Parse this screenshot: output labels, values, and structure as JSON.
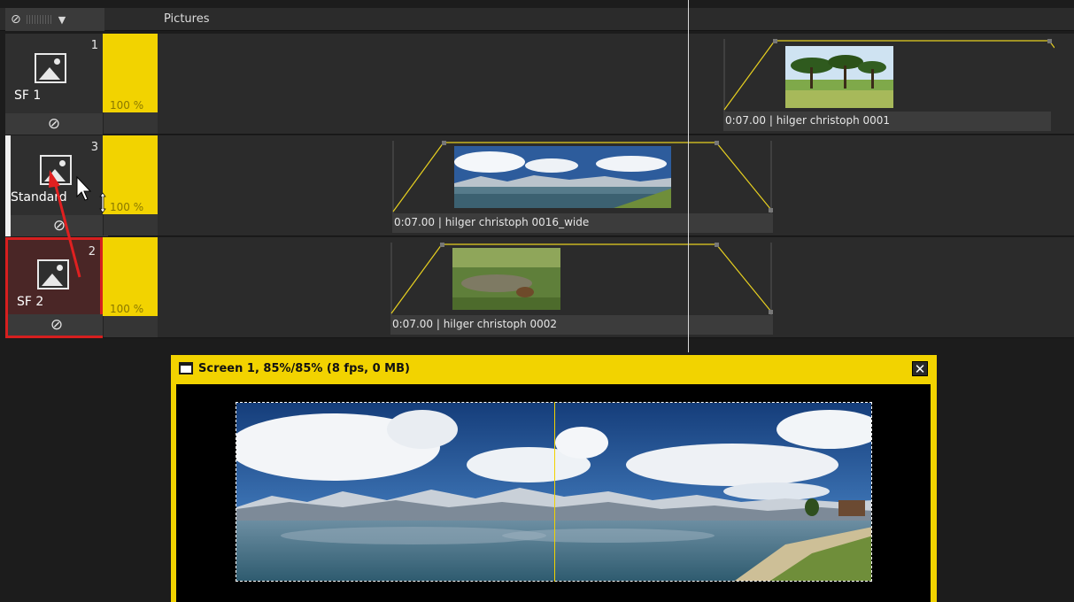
{
  "topbar": {
    "title": "Pictures",
    "no_icon": "⊘",
    "dropdown_icon": "▼"
  },
  "tracks": [
    {
      "number": "1",
      "label": "SF 1",
      "volume": "100 %",
      "footer_icon": "⊘"
    },
    {
      "number": "3",
      "label": "Standard",
      "volume": "100 %",
      "footer_icon": "⊘"
    },
    {
      "number": "2",
      "label": "SF 2",
      "volume": "100 %",
      "footer_icon": "⊘"
    }
  ],
  "clips": [
    {
      "caption": "0:07.00 | hilger christoph 0001"
    },
    {
      "caption": "0:07.00 | hilger christoph 0016_wide"
    },
    {
      "caption": "0:07.00 | hilger christoph 0002"
    }
  ],
  "preview": {
    "title": "Screen 1, 85%/85% (8 fps, 0 MB)",
    "close_icon": "✕"
  },
  "colors": {
    "accent": "#f2d300",
    "selected_border": "#d61f1f",
    "background": "#1c1c1c",
    "track": "#2b2b2b"
  }
}
